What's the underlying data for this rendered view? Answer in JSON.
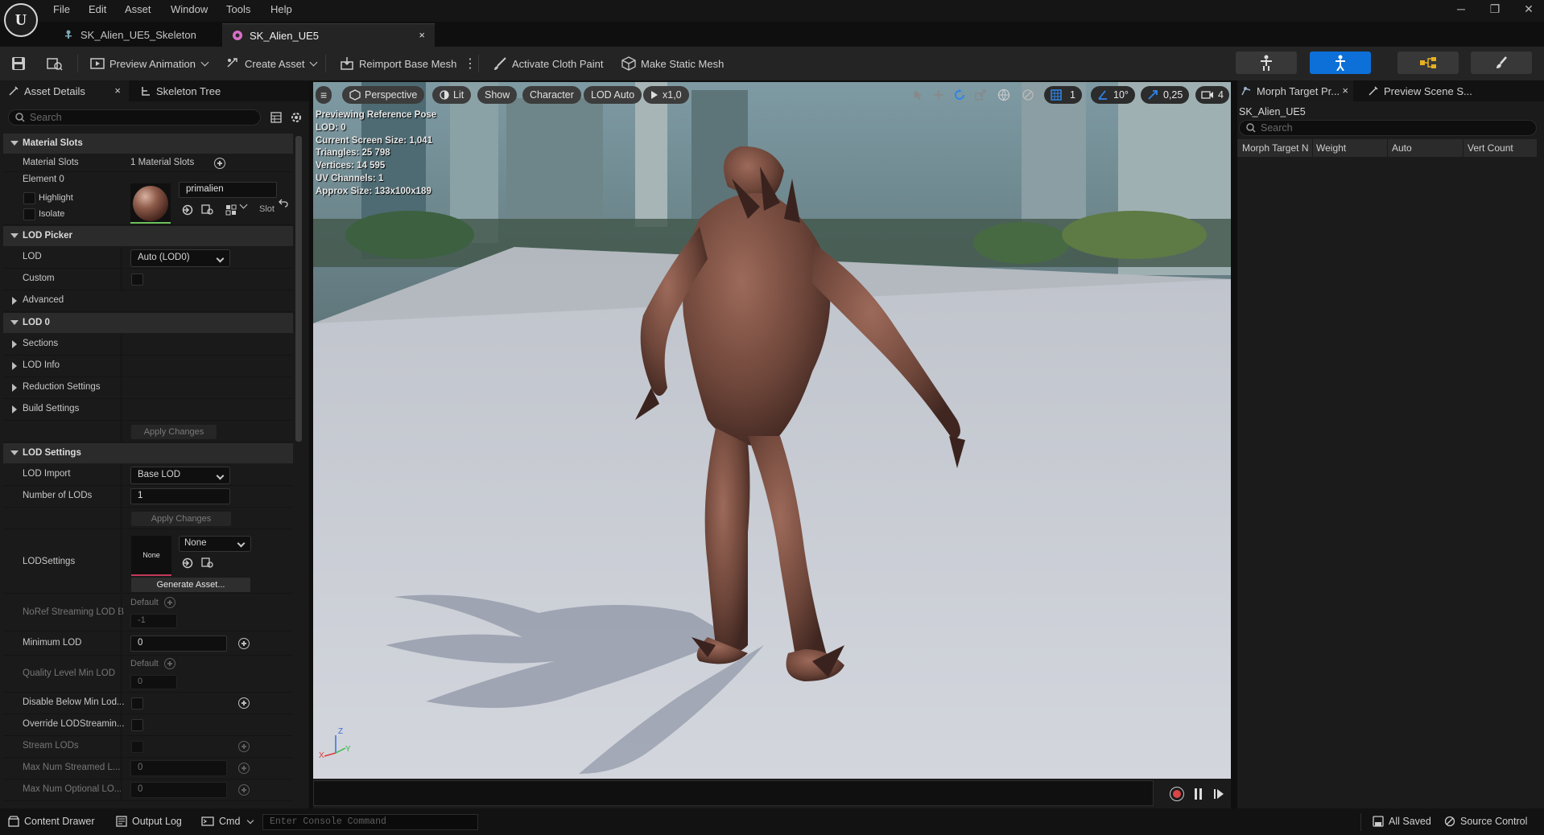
{
  "menu": {
    "items": [
      "File",
      "Edit",
      "Asset",
      "Window",
      "Tools",
      "Help"
    ]
  },
  "tabs": [
    {
      "label": "SK_Alien_UE5_Skeleton",
      "icon": "skeleton-icon"
    },
    {
      "label": "SK_Alien_UE5",
      "icon": "skeletal-mesh-icon",
      "close": "×"
    }
  ],
  "toolbar": {
    "preview_animation": "Preview Animation",
    "create_asset": "Create Asset",
    "reimport": "Reimport Base Mesh",
    "activate_cloth": "Activate Cloth Paint",
    "make_static": "Make Static Mesh"
  },
  "left_panel": {
    "tab_details": "Asset Details",
    "tab_skeleton": "Skeleton Tree",
    "close": "×",
    "search_placeholder": "Search",
    "material_slots_cat": "Material Slots",
    "material_slots_label": "Material Slots",
    "material_slots_value": "1 Material Slots",
    "element0": "Element 0",
    "highlight": "Highlight",
    "isolate": "Isolate",
    "material_name": "primalien",
    "slot": "Slot",
    "lod_picker_cat": "LOD Picker",
    "lod_label": "LOD",
    "lod_value": "Auto (LOD0)",
    "custom": "Custom",
    "advanced": "Advanced",
    "lod0_cat": "LOD 0",
    "sections": "Sections",
    "lod_info": "LOD Info",
    "reduction": "Reduction Settings",
    "build": "Build Settings",
    "apply_changes": "Apply Changes",
    "lod_settings_cat": "LOD Settings",
    "lod_import": "LOD Import",
    "lod_import_value": "Base LOD",
    "num_lods": "Number of LODs",
    "num_lods_value": "1",
    "apply_changes2": "Apply Changes",
    "lodsettings": "LODSettings",
    "lodsettings_thumb": "None",
    "lodsettings_value": "None",
    "generate_asset": "Generate Asset...",
    "noref": "NoRef Streaming LOD B",
    "noref_default": "Default",
    "noref_value": "-1",
    "min_lod": "Minimum LOD",
    "min_lod_value": "0",
    "quality_min": "Quality Level Min LOD",
    "quality_default": "Default",
    "quality_value": "0",
    "disable_below": "Disable Below Min Lod...",
    "override_streaming": "Override LODStreamin...",
    "stream_lods": "Stream LODs",
    "max_streamed": "Max Num Streamed L...",
    "max_streamed_value": "0",
    "max_optional": "Max Num Optional LO...",
    "max_optional_value": "0"
  },
  "viewport": {
    "perspective": "Perspective",
    "lit": "Lit",
    "show": "Show",
    "character": "Character",
    "lod_auto": "LOD Auto",
    "speed": "x1,0",
    "grid_value": "1",
    "angle_value": "10°",
    "scale_value": "0,25",
    "camera_value": "4",
    "stats": [
      "Previewing Reference Pose",
      "LOD: 0",
      "Current Screen Size: 1,041",
      "Triangles: 25 798",
      "Vertices: 14 595",
      "UV Channels: 1",
      "Approx Size: 133x100x189"
    ],
    "axis_z": "Z",
    "axis_x": "X",
    "axis_y": "Y"
  },
  "right_panel": {
    "tab_morph": "Morph Target Pr...",
    "tab_preview": "Preview Scene S...",
    "close": "×",
    "asset_name": "SK_Alien_UE5",
    "search_placeholder": "Search",
    "columns": [
      "Morph Target N",
      "Weight",
      "Auto",
      "Vert Count"
    ]
  },
  "statusbar": {
    "content_drawer": "Content Drawer",
    "output_log": "Output Log",
    "cmd": "Cmd",
    "console_placeholder": "Enter Console Command",
    "all_saved": "All Saved",
    "source_control": "Source Control"
  },
  "colors": {
    "accent": "#0d6fd8",
    "record": "#d94545",
    "background": "#1a1a1a"
  }
}
